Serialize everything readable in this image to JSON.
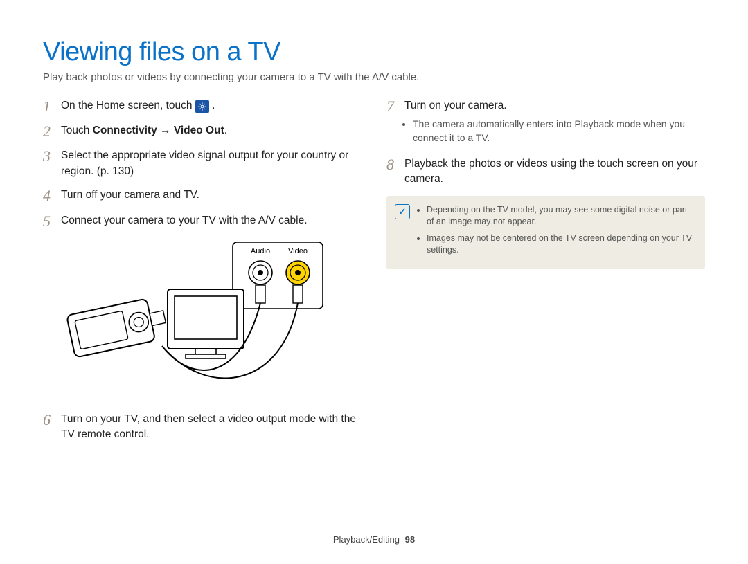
{
  "title": "Viewing files on a TV",
  "subtitle": "Play back photos or videos by connecting your camera to a TV with the A/V cable.",
  "left_steps": {
    "s1_a": "On the Home screen, touch ",
    "s1_b": ".",
    "s2_a": "Touch ",
    "s2_b": "Connectivity",
    "s2_c": " → ",
    "s2_d": "Video Out",
    "s2_e": ".",
    "s3": "Select the appropriate video signal output for your country or region. (p. 130)",
    "s4": "Turn off your camera and TV.",
    "s5": "Connect your camera to your TV with the A/V cable.",
    "s6": "Turn on your TV, and then select a video output mode with the TV remote control."
  },
  "diagram_labels": {
    "audio": "Audio",
    "video": "Video"
  },
  "right_steps": {
    "s7": "Turn on your camera.",
    "s7_bullet": "The camera automatically enters into Playback mode when you connect it to a TV.",
    "s8": "Playback the photos or videos using the touch screen on your camera."
  },
  "note": {
    "b1": "Depending on the TV model, you may see some digital noise or part of an image may not appear.",
    "b2": "Images may not be centered on the TV screen depending on your TV settings."
  },
  "footer_section": "Playback/Editing",
  "footer_page": "98"
}
